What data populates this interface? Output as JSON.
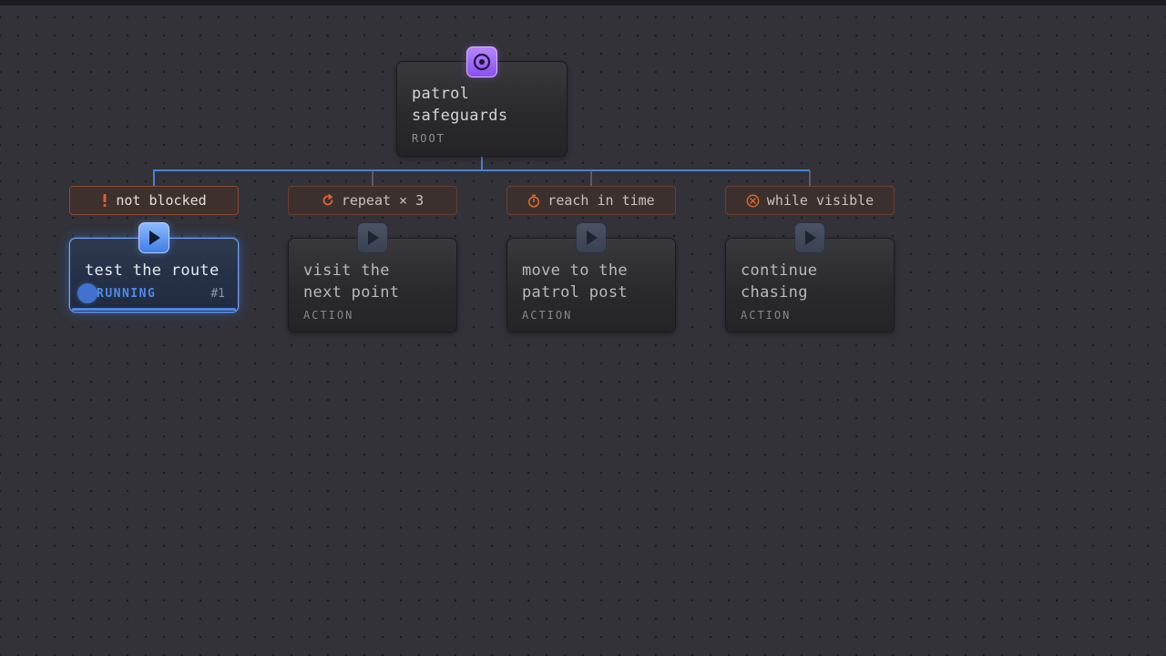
{
  "colors": {
    "edge": "#4a80d4",
    "root_accent": "#9a65f8",
    "running_accent": "#4f86e6",
    "decorator_accent": "#d9672f"
  },
  "root": {
    "title_line1": "patrol",
    "title_line2": "safeguards",
    "type": "ROOT",
    "icon": "target-icon"
  },
  "branches": [
    {
      "decorator": {
        "label": "not blocked",
        "icon": "exclamation-icon"
      },
      "node": {
        "title_line1": "test the route",
        "status": "RUNNING",
        "run_count": "#1",
        "progress": 1.0,
        "icon": "play-icon"
      }
    },
    {
      "decorator": {
        "label": "repeat × 3",
        "icon": "repeat-icon"
      },
      "node": {
        "title_line1": "visit the",
        "title_line2": "next point",
        "type": "ACTION",
        "icon": "play-icon"
      }
    },
    {
      "decorator": {
        "label": "reach in time",
        "icon": "timer-icon"
      },
      "node": {
        "title_line1": "move to the",
        "title_line2": "patrol post",
        "type": "ACTION",
        "icon": "play-icon"
      }
    },
    {
      "decorator": {
        "label": "while visible",
        "icon": "cancel-circle-icon"
      },
      "node": {
        "title_line1": "continue",
        "title_line2": "chasing",
        "type": "ACTION",
        "icon": "play-icon"
      }
    }
  ]
}
